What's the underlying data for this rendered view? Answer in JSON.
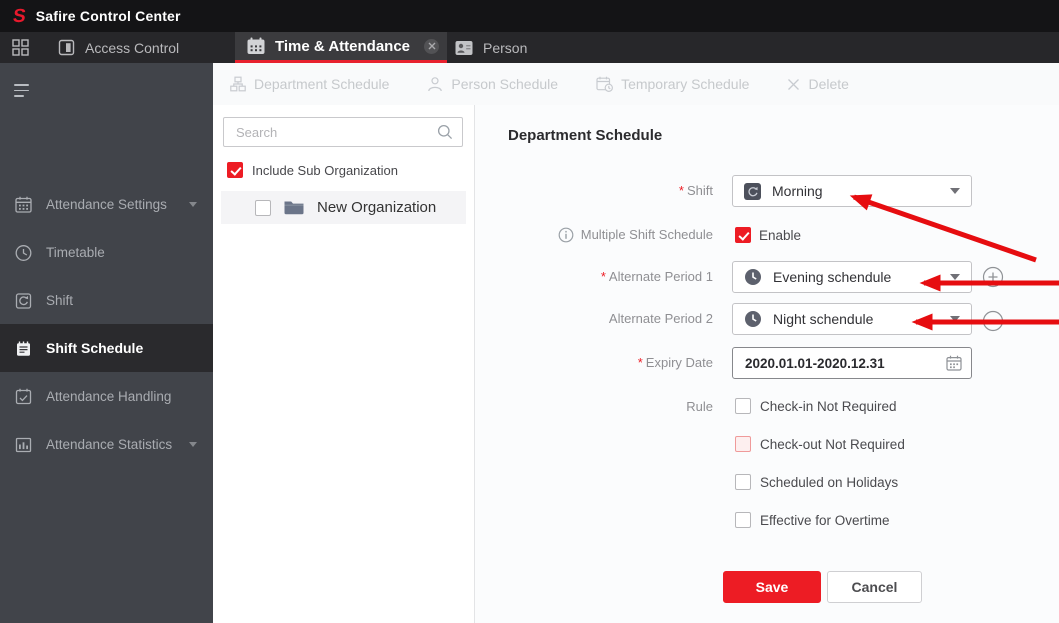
{
  "colors": {
    "accent_red": "#ed1c24",
    "logo_red": "#e8192c",
    "arrow_red": "#e60d10",
    "tab_underline": "#e8212e"
  },
  "header": {
    "logo_letter": "S",
    "app_title": "Safire Control Center"
  },
  "tabbar": {
    "tabs": [
      {
        "label": "Access Control",
        "active": false
      },
      {
        "label": "Time & Attendance",
        "active": true,
        "closable": true
      },
      {
        "label": "Person",
        "active": false
      }
    ]
  },
  "sidebar": {
    "items": [
      {
        "label": "Attendance Settings",
        "expandable": true,
        "active": false
      },
      {
        "label": "Timetable",
        "expandable": false,
        "active": false
      },
      {
        "label": "Shift",
        "expandable": false,
        "active": false
      },
      {
        "label": "Shift Schedule",
        "expandable": false,
        "active": true
      },
      {
        "label": "Attendance Handling",
        "expandable": false,
        "active": false
      },
      {
        "label": "Attendance Statistics",
        "expandable": true,
        "active": false
      }
    ]
  },
  "toolbar": {
    "items": [
      {
        "label": "Department Schedule",
        "enabled": false
      },
      {
        "label": "Person Schedule",
        "enabled": false
      },
      {
        "label": "Temporary Schedule",
        "enabled": false
      },
      {
        "label": "Delete",
        "enabled": false
      }
    ]
  },
  "tree": {
    "search_placeholder": "Search",
    "include_sub_label": "Include Sub Organization",
    "include_sub_checked": true,
    "nodes": [
      {
        "label": "New Organization",
        "checked": false
      }
    ]
  },
  "form": {
    "title": "Department Schedule",
    "required_marker": "*",
    "shift": {
      "label": "Shift",
      "required": true,
      "value": "Morning"
    },
    "multiple_shift": {
      "label": "Multiple Shift Schedule",
      "checkbox_label": "Enable",
      "checked": true
    },
    "alternate_period_1": {
      "label": "Alternate Period 1",
      "required": true,
      "value": "Evening schendule"
    },
    "alternate_period_2": {
      "label": "Alternate Period 2",
      "required": false,
      "value": "Night schendule"
    },
    "expiry_date": {
      "label": "Expiry Date",
      "required": true,
      "value": "2020.01.01-2020.12.31"
    },
    "rule": {
      "label": "Rule",
      "options": [
        {
          "label": "Check-in Not Required",
          "checked": false,
          "highlighted": false
        },
        {
          "label": "Check-out Not Required",
          "checked": false,
          "highlighted": true
        },
        {
          "label": "Scheduled on Holidays",
          "checked": false,
          "highlighted": false
        },
        {
          "label": "Effective for Overtime",
          "checked": false,
          "highlighted": false
        }
      ]
    },
    "buttons": {
      "save": "Save",
      "cancel": "Cancel"
    }
  }
}
